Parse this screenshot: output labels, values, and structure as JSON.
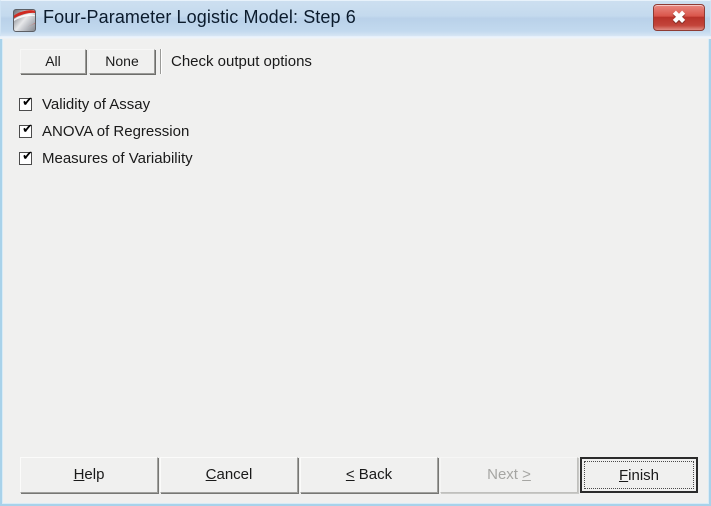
{
  "window": {
    "title": "Four-Parameter Logistic Model: Step 6",
    "app_icon": "minitab-icon",
    "close_label": "✖",
    "titlebar_color": "#c2d9ee",
    "frame_color": "#a8d2ea",
    "client_color": "#f0f0ef"
  },
  "toolbar": {
    "all_label": "All",
    "none_label": "None",
    "instruction": "Check output options"
  },
  "options": [
    {
      "label": "Validity of Assay",
      "checked": true,
      "mark": "✔"
    },
    {
      "label": "ANOVA of Regression",
      "checked": true,
      "mark": "✔"
    },
    {
      "label": "Measures of Variability",
      "checked": true,
      "mark": "✔"
    }
  ],
  "buttons": {
    "help": {
      "prefix": "",
      "accel": "H",
      "suffix": "elp",
      "enabled": true,
      "default": false
    },
    "cancel": {
      "prefix": "",
      "accel": "C",
      "suffix": "ancel",
      "enabled": true,
      "default": false
    },
    "back": {
      "prefix": "",
      "accel": "<",
      "suffix": " Back",
      "enabled": true,
      "default": false
    },
    "next": {
      "prefix": "Next ",
      "accel": ">",
      "suffix": "",
      "enabled": false,
      "default": false
    },
    "finish": {
      "prefix": "",
      "accel": "F",
      "suffix": "inish",
      "enabled": true,
      "default": true
    }
  }
}
